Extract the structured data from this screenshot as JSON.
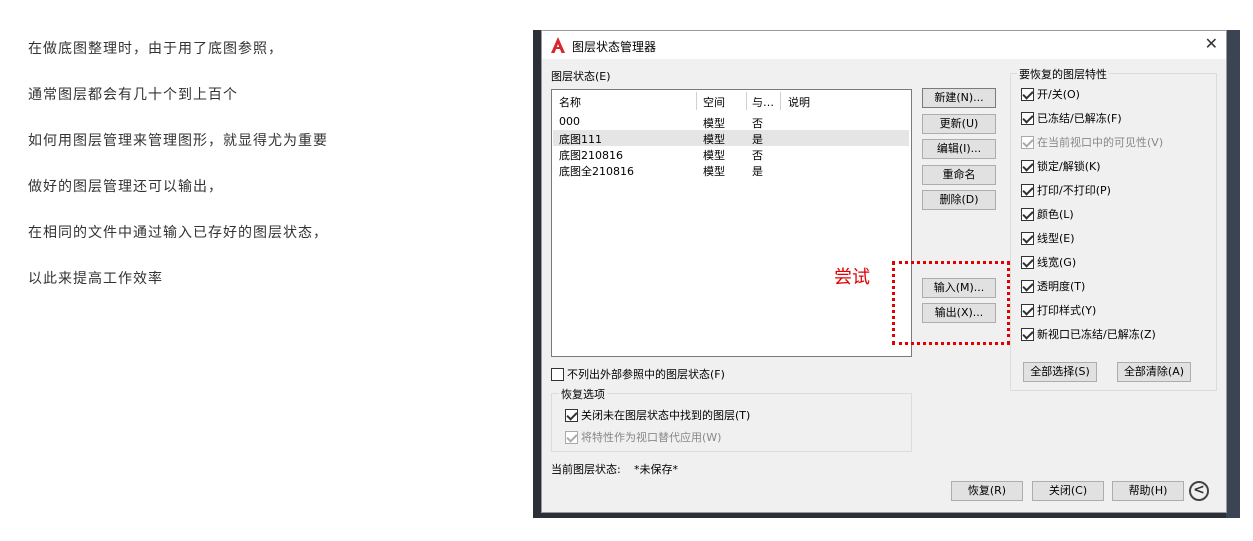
{
  "article": {
    "lines": [
      "在做底图整理时，由于用了底图参照，",
      "通常图层都会有几十个到上百个",
      "如何用图层管理来管理图形，就显得尤为重要",
      "做好的图层管理还可以输出，",
      "在相同的文件中通过输入已存好的图层状态，",
      "以此来提高工作效率"
    ]
  },
  "dialog": {
    "title": "图层状态管理器",
    "close_label": "✕",
    "states_label": "图层状态(E)",
    "columns": [
      "名称",
      "空间",
      "与…",
      "说明"
    ],
    "rows": [
      {
        "name": "000",
        "space": "模型",
        "same": "否",
        "desc": ""
      },
      {
        "name": "底图111",
        "space": "模型",
        "same": "是",
        "desc": ""
      },
      {
        "name": "底图210816",
        "space": "模型",
        "same": "否",
        "desc": ""
      },
      {
        "name": "底图全210816",
        "space": "模型",
        "same": "是",
        "desc": ""
      }
    ],
    "buttons": {
      "new": "新建(N)...",
      "update": "更新(U)",
      "edit": "编辑(I)...",
      "rename": "重命名",
      "delete": "删除(D)",
      "import": "输入(M)...",
      "export": "输出(X)..."
    },
    "no_xref_label": "不列出外部参照中的图层状态(F)",
    "restore_options_title": "恢复选项",
    "restore_off_label": "关闭未在图层状态中找到的图层(T)",
    "restore_vp_label": "将特性作为视口替代应用(W)",
    "current_state_label": "当前图层状态:",
    "current_state_value": "*未保存*",
    "props_title": "要恢复的图层特性",
    "props": [
      {
        "label": "开/关(O)",
        "checked": true,
        "disabled": false
      },
      {
        "label": "已冻结/已解冻(F)",
        "checked": true,
        "disabled": false
      },
      {
        "label": "在当前视口中的可见性(V)",
        "checked": true,
        "disabled": true
      },
      {
        "label": "锁定/解锁(K)",
        "checked": true,
        "disabled": false
      },
      {
        "label": "打印/不打印(P)",
        "checked": true,
        "disabled": false
      },
      {
        "label": "颜色(L)",
        "checked": true,
        "disabled": false
      },
      {
        "label": "线型(E)",
        "checked": true,
        "disabled": false
      },
      {
        "label": "线宽(G)",
        "checked": true,
        "disabled": false
      },
      {
        "label": "透明度(T)",
        "checked": true,
        "disabled": false
      },
      {
        "label": "打印样式(Y)",
        "checked": true,
        "disabled": false
      },
      {
        "label": "新视口已冻结/已解冻(Z)",
        "checked": true,
        "disabled": false
      }
    ],
    "select_all": "全部选择(S)",
    "clear_all": "全部清除(A)",
    "footer": {
      "restore": "恢复(R)",
      "close": "关闭(C)",
      "help": "帮助(H)",
      "back_icon": "<"
    }
  },
  "annotation": {
    "text": "尝试",
    "color": "#e00000"
  }
}
